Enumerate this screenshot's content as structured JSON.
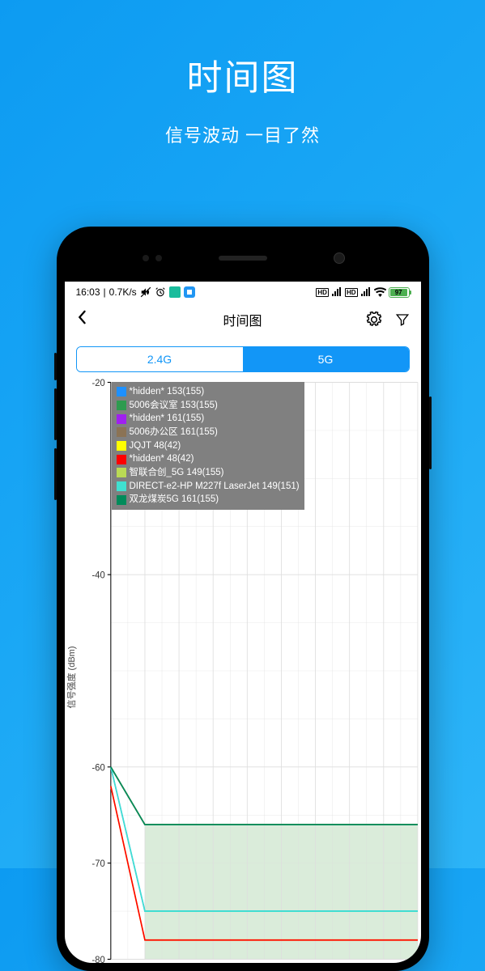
{
  "hero": {
    "title": "时间图",
    "subtitle": "信号波动 一目了然"
  },
  "statusBar": {
    "time": "16:03",
    "speed": "0.7K/s",
    "battery": "97"
  },
  "appHeader": {
    "title": "时间图"
  },
  "tabs": {
    "tab24g": "2.4G",
    "tab5g": "5G"
  },
  "chart_data": {
    "type": "line",
    "ylabel": "信号强度 (dBm)",
    "ylim": [
      -80,
      -20
    ],
    "yticks": [
      -20,
      -40,
      -60,
      -70,
      -80
    ],
    "x_range": [
      0,
      9
    ],
    "series": [
      {
        "name": "*hidden* 153(155)",
        "color": "#1e90ff",
        "points": [
          [
            0,
            -60
          ],
          [
            1,
            -75
          ],
          [
            9,
            -75
          ]
        ]
      },
      {
        "name": "5006会议室 153(155)",
        "color": "#2e9b4f",
        "points": [
          [
            0,
            -60
          ],
          [
            1,
            -66
          ],
          [
            9,
            -66
          ]
        ]
      },
      {
        "name": "*hidden* 161(155)",
        "color": "#a020f0",
        "points": [
          [
            0,
            -60
          ],
          [
            1,
            -66
          ],
          [
            9,
            -66
          ]
        ]
      },
      {
        "name": "5006办公区 161(155)",
        "color": "#8b7355",
        "points": [
          [
            0,
            -60
          ],
          [
            1,
            -66
          ],
          [
            9,
            -66
          ]
        ]
      },
      {
        "name": "JQJT 48(42)",
        "color": "#ffff00",
        "points": [
          [
            0,
            -62
          ],
          [
            1,
            -78
          ],
          [
            9,
            -78
          ]
        ]
      },
      {
        "name": "*hidden* 48(42)",
        "color": "#ff0000",
        "points": [
          [
            0,
            -62
          ],
          [
            1,
            -78
          ],
          [
            2,
            -78
          ],
          [
            9,
            -78
          ]
        ]
      },
      {
        "name": "智联合创_5G 149(155)",
        "color": "#bada55",
        "points": [
          [
            0,
            -60
          ],
          [
            1,
            -66
          ],
          [
            9,
            -66
          ]
        ]
      },
      {
        "name": "DIRECT-e2-HP M227f LaserJet 149(151)",
        "color": "#40e0d0",
        "points": [
          [
            0,
            -60
          ],
          [
            1,
            -75
          ],
          [
            9,
            -75
          ]
        ]
      },
      {
        "name": "双龙煤炭5G 161(155)",
        "color": "#008b5a",
        "points": [
          [
            0,
            -60
          ],
          [
            1,
            -66
          ],
          [
            9,
            -66
          ]
        ]
      }
    ],
    "shaded_region": {
      "from_y": -66,
      "to_y": -80,
      "color": "rgba(150,200,150,0.35)",
      "from_x": 1,
      "to_x": 9
    }
  }
}
